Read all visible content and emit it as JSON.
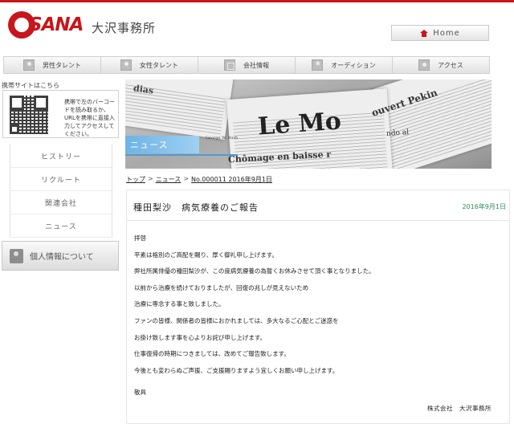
{
  "header": {
    "logo_text": "SANA",
    "brand_name": "大沢事務所",
    "home_label": "Home"
  },
  "nav": {
    "items": [
      {
        "label": "男性タレント",
        "icon": "person-icon"
      },
      {
        "label": "女性タレント",
        "icon": "person-icon"
      },
      {
        "label": "会社情報",
        "icon": "building-icon"
      },
      {
        "label": "オーディション",
        "icon": "star-icon"
      },
      {
        "label": "アクセス",
        "icon": "pin-icon"
      }
    ]
  },
  "sidebar": {
    "mobile_label": "携帯サイトはこちら",
    "qr_text": "携帯で左のバーコードを読み取るか、URLを携帯に直接入力してアクセスしてください。",
    "links": [
      "ヒストリー",
      "リクルート",
      "関連会社",
      "ニュース"
    ],
    "privacy_label": "個人情報について"
  },
  "banner": {
    "tag": "ニュース",
    "paper_headline_main": "Le Mo",
    "paper_headline_sub": "Chômage en baisse r",
    "paper_small": "George W. Bush",
    "paper_headline_right": "ouvert Pekin",
    "paper_headline_left": "dias",
    "paper_headline_lower": "ndo al"
  },
  "breadcrumb": {
    "top": "トップ",
    "news": "ニュース",
    "current": "No.000011 2016年9月1日",
    "sep": ">"
  },
  "article": {
    "title": "種田梨沙　病気療養のご報告",
    "date": "2016年9月1日",
    "lines": [
      "拝啓",
      "平素は格別のご高配を賜り、厚く御礼申し上げます。",
      "弊社所属俳優の種田梨沙が、この度病気療養の為暫くお休みさせて頂く事となりました。",
      "以前から治療を続けておりましたが、回復の兆しが見えないため",
      "治療に専念する事と致しました。",
      "ファンの皆様、関係者の皆様におかれましては、多大なるご心配とご迷惑を",
      "お掛け致します事を心よりお詫び申し上げます。",
      "仕事復帰の時期につきましては、改めてご報告致します。",
      "今後とも変わらぬご声援、ご支援賜りますよう宜しくお願い申し上げます。"
    ],
    "closing": "敬具",
    "signature": "株式会社　大沢事務所"
  }
}
